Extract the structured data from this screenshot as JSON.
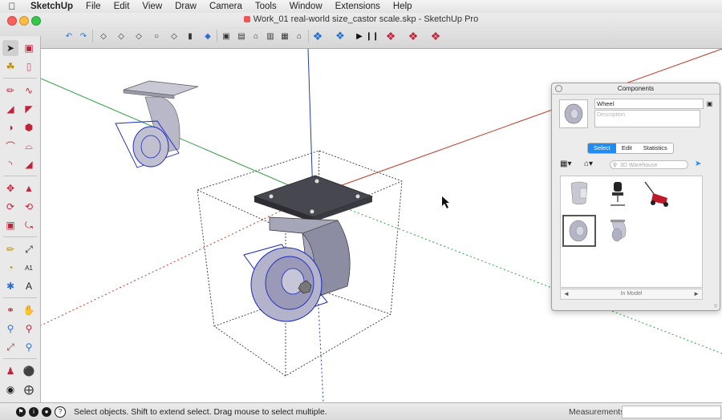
{
  "menubar": {
    "app_name": "SketchUp",
    "items": [
      "File",
      "Edit",
      "View",
      "Draw",
      "Camera",
      "Tools",
      "Window",
      "Extensions",
      "Help"
    ]
  },
  "window": {
    "title": "Work_01 real-world size_castor scale.skp - SketchUp Pro"
  },
  "colors": {
    "close": "#fc605c",
    "minimize": "#fdbc40",
    "zoom": "#34c84a",
    "accent": "#1f8cf4",
    "axis_red": "#c0392b",
    "axis_green": "#2ea043",
    "axis_blue": "#1f3fb0"
  },
  "components": {
    "panel_title": "Components",
    "name_value": "Wheel",
    "description_placeholder": "Description",
    "tabs": [
      "Select",
      "Edit",
      "Statistics"
    ],
    "active_tab": "Select",
    "search_placeholder": "3D Warehouse",
    "footer_label": "In Model",
    "items": [
      "chair-shell",
      "office-chair",
      "lawn-mower",
      "wheel",
      "castor"
    ],
    "selected_item": "wheel"
  },
  "status": {
    "hint": "Select objects. Shift to extend select. Drag mouse to select multiple.",
    "measurements_label": "Measurements",
    "measurements_value": ""
  }
}
